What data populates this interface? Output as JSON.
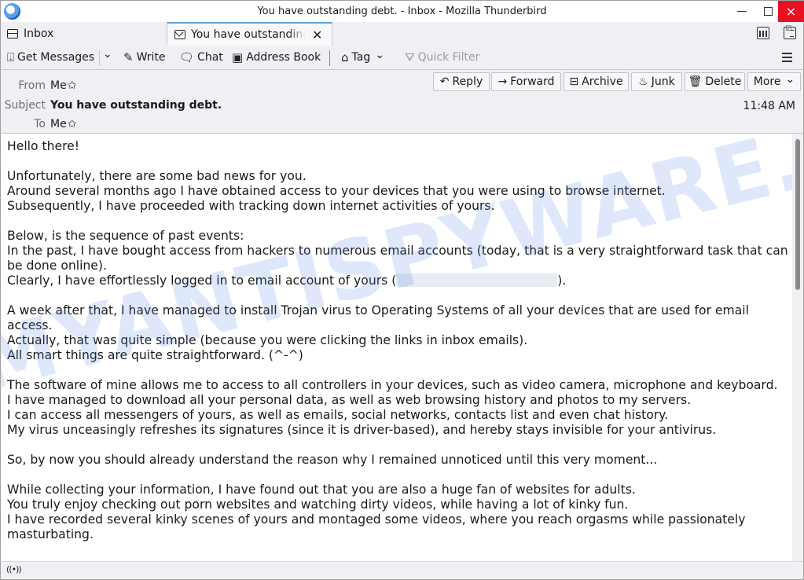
{
  "window": {
    "title": "You have outstanding debt. - Inbox - Mozilla Thunderbird",
    "app_icon": "thunderbird-logo-icon",
    "controls": {
      "minimize": "minimize",
      "maximize": "maximize",
      "close": "×"
    }
  },
  "tabs": [
    {
      "label": "Inbox",
      "icon": "inbox-tray-icon",
      "active": false
    },
    {
      "label": "You have outstanding debt.",
      "icon": "envelope-icon",
      "active": true,
      "close_glyph": "✕"
    }
  ],
  "tab_bar_icons": [
    "calendar-icon",
    "tasks-icon"
  ],
  "toolbar": {
    "get_messages": "Get Messages",
    "get_messages_dropdown": "⌄",
    "write": "Write",
    "chat": "Chat",
    "address_book": "Address Book",
    "tag": "Tag",
    "tag_dropdown": "⌄",
    "quick_filter": "Quick Filter",
    "menu_icon": "hamburger-menu-icon"
  },
  "header": {
    "from_label": "From",
    "from_value": "Me",
    "subject_label": "Subject",
    "subject_value": "You have outstanding debt.",
    "to_label": "To",
    "to_value": "Me",
    "star": "✩",
    "time": "11:48 AM",
    "buttons": {
      "reply": "Reply",
      "forward": "Forward",
      "archive": "Archive",
      "junk": "Junk",
      "delete": "Delete",
      "more": "More"
    }
  },
  "body": {
    "lines_before_redaction": "Hello there!\n\nUnfortunately, there are some bad news for you.\nAround several months ago I have obtained access to your devices that you were using to browse internet.\nSubsequently, I have proceeded with tracking down internet activities of yours.\n\nBelow, is the sequence of past events:\nIn the past, I have bought access from hackers to numerous email accounts (today, that is a very straightforward task that can be done online).\nClearly, I have effortlessly logged in to email account of yours (",
    "redacted_email": "",
    "lines_after_redaction": ").\n\nA week after that, I have managed to install Trojan virus to Operating Systems of all your devices that are used for email access.\nActually, that was quite simple (because you were clicking the links in inbox emails).\nAll smart things are quite straightforward. (^-^)\n\nThe software of mine allows me to access to all controllers in your devices, such as video camera, microphone and keyboard.\nI have managed to download all your personal data, as well as web browsing history and photos to my servers.\nI can access all messengers of yours, as well as emails, social networks, contacts list and even chat history.\nMy virus unceasingly refreshes its signatures (since it is driver-based), and hereby stays invisible for your antivirus.\n\nSo, by now you should already understand the reason why I remained unnoticed until this very moment...\n\nWhile collecting your information, I have found out that you are also a huge fan of websites for adults.\nYou truly enjoy checking out porn websites and watching dirty videos, while having a lot of kinky fun.\nI have recorded several kinky scenes of yours and montaged some videos, where you reach orgasms while passionately masturbating.",
    "watermark": "MYANTISPYWARE.COM"
  },
  "statusbar": {
    "activity_icon": "((•))"
  }
}
